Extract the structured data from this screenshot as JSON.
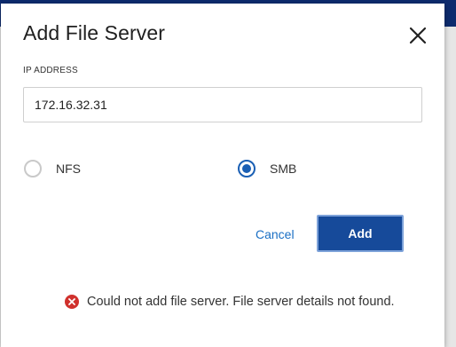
{
  "dialog": {
    "title": "Add File Server",
    "close_icon": "close-icon"
  },
  "ip_field": {
    "label": "IP ADDRESS",
    "value": "172.16.32.31"
  },
  "protocol": {
    "options": [
      {
        "label": "NFS",
        "selected": false
      },
      {
        "label": "SMB",
        "selected": true
      }
    ]
  },
  "actions": {
    "cancel_label": "Cancel",
    "add_label": "Add"
  },
  "error": {
    "icon": "error-circle-icon",
    "message": "Could not add file server. File server details not found."
  },
  "colors": {
    "accent": "#164a9a",
    "link": "#1a6fc4",
    "error": "#d0312d",
    "radio_selected": "#1a5fb4"
  }
}
